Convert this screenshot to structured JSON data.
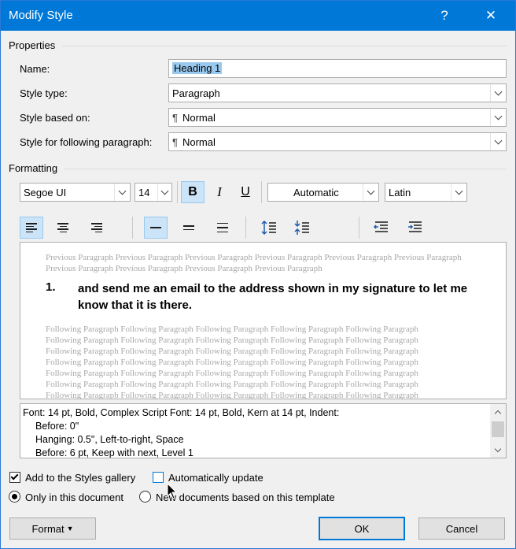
{
  "window": {
    "title": "Modify Style",
    "help_glyph": "?",
    "close_glyph": "✕"
  },
  "properties": {
    "section_label": "Properties",
    "name_label": "Name:",
    "name_value": "Heading 1",
    "style_type_label": "Style type:",
    "style_type_value": "Paragraph",
    "based_on_label": "Style based on:",
    "based_on_value": "Normal",
    "following_label": "Style for following paragraph:",
    "following_value": "Normal"
  },
  "formatting": {
    "section_label": "Formatting",
    "font": "Segoe UI",
    "size": "14",
    "bold": "B",
    "italic": "I",
    "underline": "U",
    "color": "Automatic",
    "script": "Latin"
  },
  "preview": {
    "previous_text": "Previous Paragraph Previous Paragraph Previous Paragraph Previous Paragraph Previous Paragraph Previous Paragraph Previous Paragraph Previous Paragraph Previous Paragraph Previous Paragraph",
    "heading_number": "1.",
    "heading_text": "and send me an email to the address shown in my signature to let me know that it is there.",
    "following_lines": [
      "Following Paragraph Following Paragraph Following Paragraph Following Paragraph Following Paragraph",
      "Following Paragraph Following Paragraph Following Paragraph Following Paragraph Following Paragraph",
      "Following Paragraph Following Paragraph Following Paragraph Following Paragraph Following Paragraph",
      "Following Paragraph Following Paragraph Following Paragraph Following Paragraph Following Paragraph",
      "Following Paragraph Following Paragraph Following Paragraph Following Paragraph Following Paragraph",
      "Following Paragraph Following Paragraph Following Paragraph Following Paragraph Following Paragraph",
      "Following Paragraph Following Paragraph Following Paragraph Following Paragraph Following Paragraph"
    ]
  },
  "description": {
    "line1": "Font: 14 pt, Bold, Complex Script Font: 14 pt, Bold, Kern at 14 pt, Indent:",
    "line2": "Before:  0\"",
    "line3": "Hanging:  0.5\", Left-to-right, Space",
    "line4": "Before:  6 pt, Keep with next, Level 1"
  },
  "options": {
    "add_to_gallery": "Add to the Styles gallery",
    "auto_update": "Automatically update",
    "only_this_doc": "Only in this document",
    "new_docs": "New documents based on this template"
  },
  "buttons": {
    "format": "Format",
    "ok": "OK",
    "cancel": "Cancel"
  },
  "colors": {
    "title_bar": "#0078d7",
    "selection": "#99c9ef",
    "active_button": "#cce4f7"
  }
}
